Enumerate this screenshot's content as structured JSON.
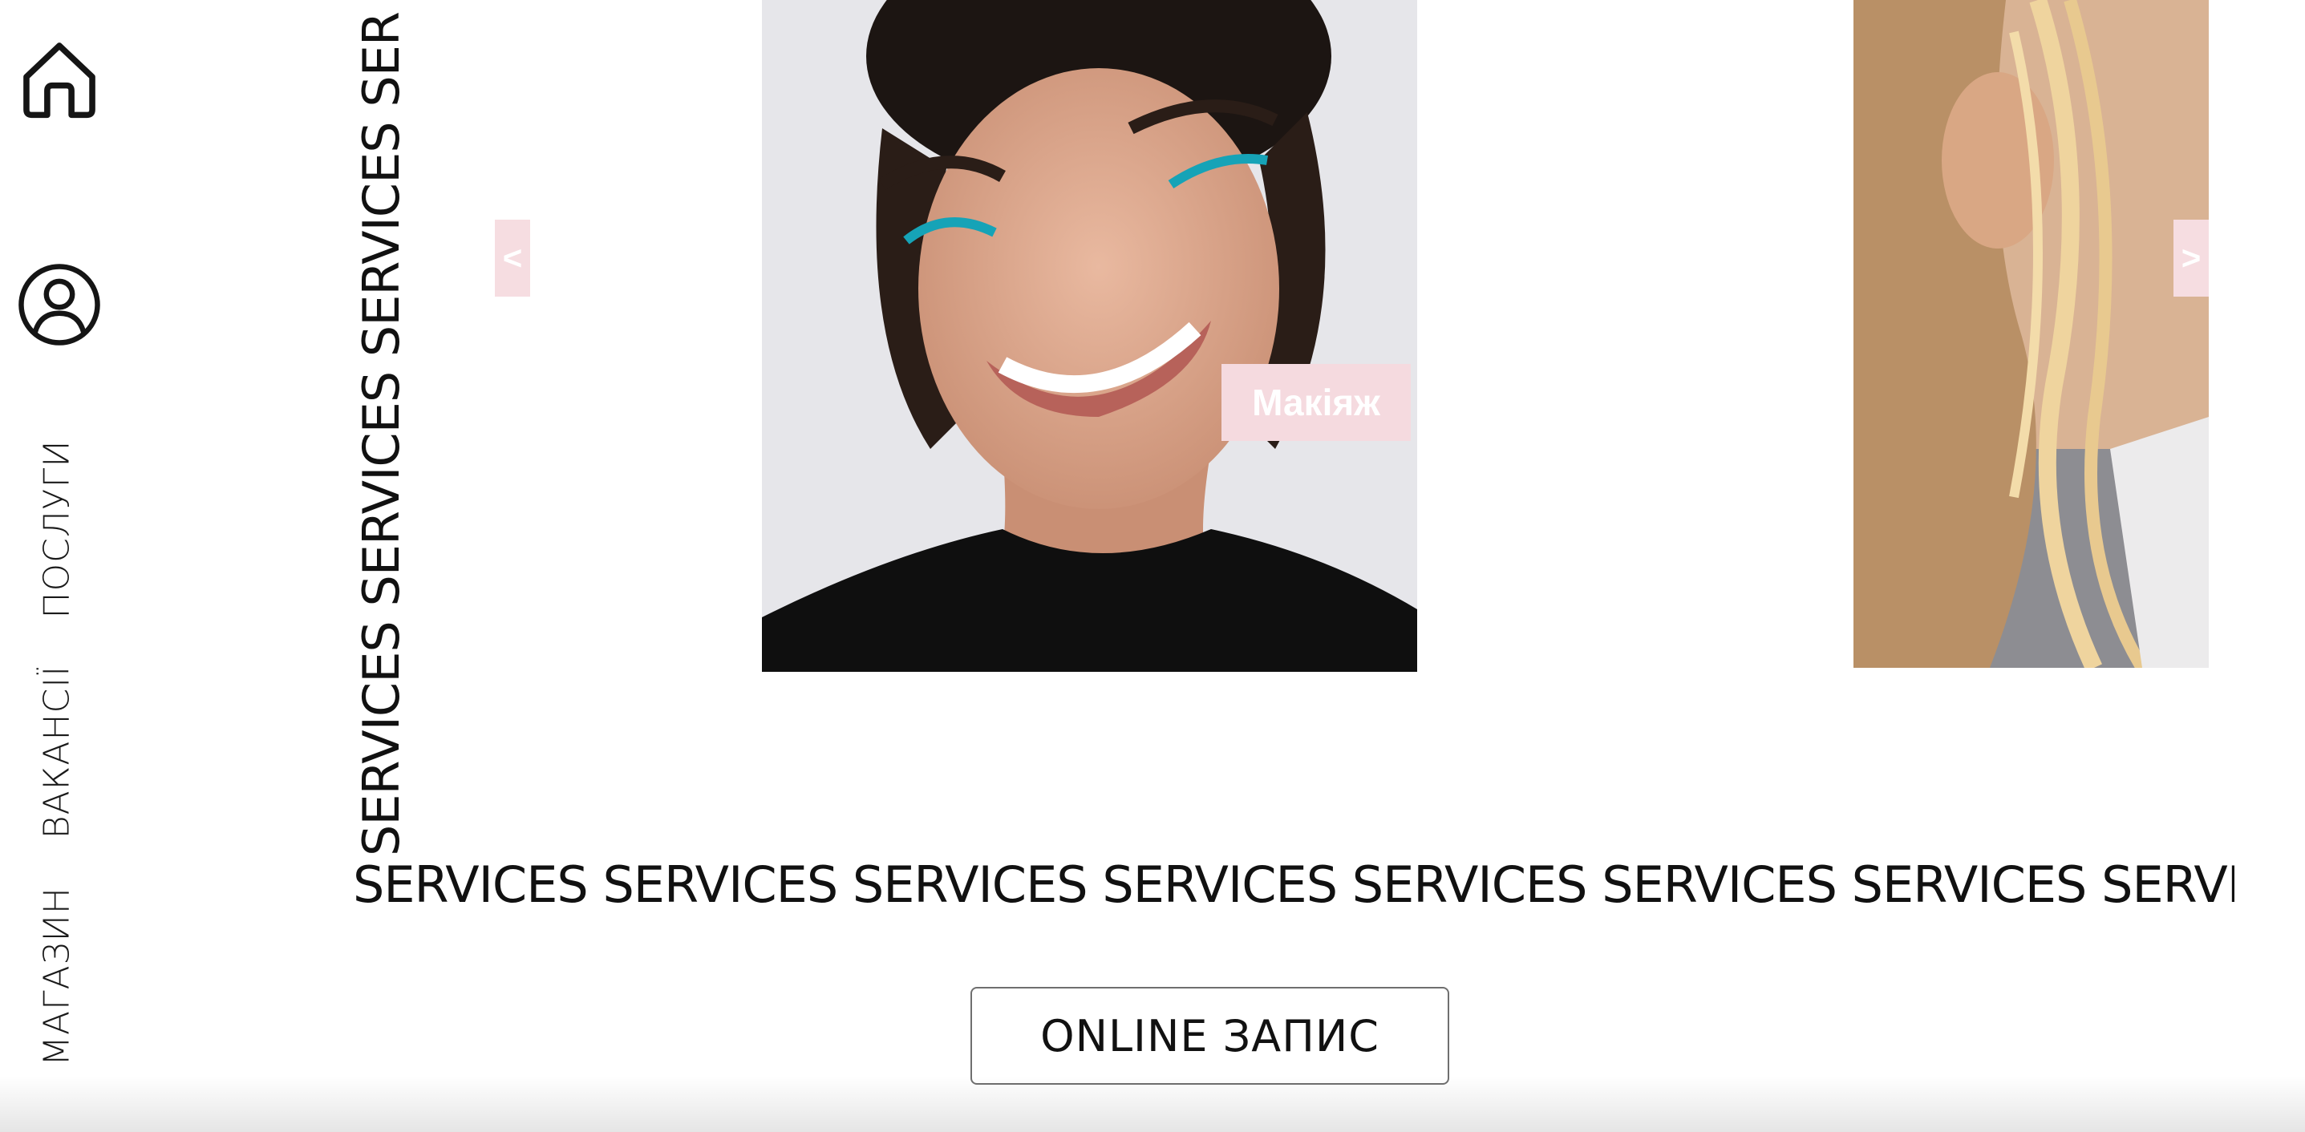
{
  "sidebar": {
    "home_icon": "home-icon",
    "profile_icon": "user-circle-icon",
    "nav": {
      "services": "ПОСЛУГИ",
      "vacancies": "ВАКАНСІЇ",
      "shop": "МАГАЗИН"
    }
  },
  "marquee": {
    "vertical": "SERVICES SERVICES SERVICES SER",
    "horizontal": "SERVICES SERVICES SERVICES SERVICES SERVICES SERVICES SERVICES SERVI"
  },
  "carousel": {
    "prev_label": "<",
    "next_label": ">",
    "active_badge": "Макіяж"
  },
  "cta": {
    "label": "ONLINE ЗАПИС"
  },
  "colors": {
    "accent_pink": "#f5dadf",
    "text": "#111111",
    "background": "#ffffff"
  }
}
